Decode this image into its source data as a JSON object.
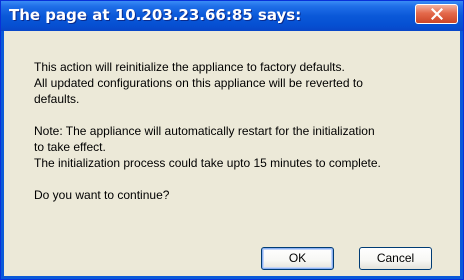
{
  "dialog": {
    "title": "The page at 10.203.23.66:85 says:",
    "close_icon": "close-x-icon",
    "message": {
      "line1": "This action will reinitialize the appliance to factory defaults.",
      "line2": "All updated configurations on this appliance will be reverted to",
      "line3": "defaults.",
      "line4": "Note: The appliance will automatically restart for the initialization",
      "line5": "to take effect.",
      "line6": "The initialization process could take upto 15 minutes to complete.",
      "line7": "Do you want to continue?"
    },
    "buttons": {
      "ok_label": "OK",
      "cancel_label": "Cancel"
    }
  }
}
